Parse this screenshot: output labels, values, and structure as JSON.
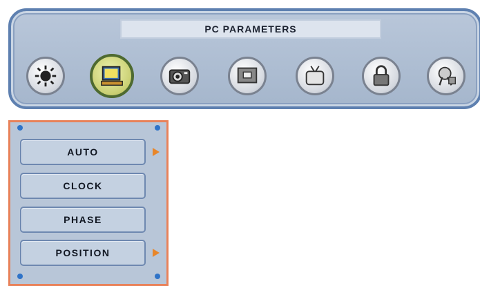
{
  "header": {
    "title": "PC PARAMETERS"
  },
  "toolbar": {
    "icons": [
      {
        "name": "brightness-icon",
        "selected": false
      },
      {
        "name": "pc-monitor-icon",
        "selected": true
      },
      {
        "name": "camera-icon",
        "selected": false
      },
      {
        "name": "screen-frame-icon",
        "selected": false
      },
      {
        "name": "tv-icon",
        "selected": false
      },
      {
        "name": "lock-icon",
        "selected": false
      },
      {
        "name": "settings-icon",
        "selected": false
      }
    ]
  },
  "menu": {
    "items": [
      {
        "label": "AUTO",
        "has_arrow": true
      },
      {
        "label": "CLOCK",
        "has_arrow": false
      },
      {
        "label": "PHASE",
        "has_arrow": false
      },
      {
        "label": "POSITION",
        "has_arrow": true
      }
    ]
  },
  "colors": {
    "panel_border": "#5e80b0",
    "menu_border": "#e8825a",
    "arrow": "#e8862a",
    "dot": "#2f73c8"
  }
}
